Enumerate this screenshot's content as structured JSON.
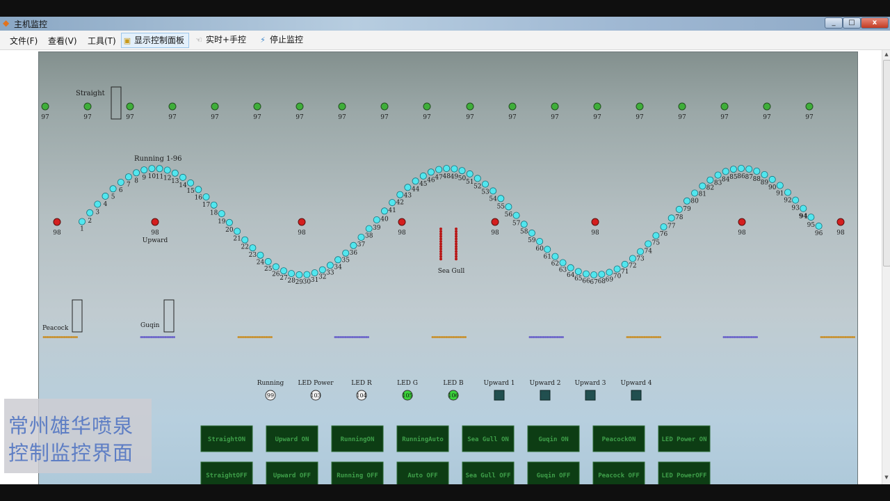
{
  "window": {
    "title": "主机监控",
    "controls": [
      "_",
      "□",
      "x"
    ]
  },
  "menu": {
    "file": "文件(F)",
    "view": "查看(V)",
    "tools": "工具(T)",
    "show_panel": "显示控制面板",
    "realtime": "实时+手控",
    "stop": "停止监控"
  },
  "labels": {
    "straight": "Straight",
    "running": "Running 1-96",
    "upward": "Upward",
    "seagull": "Sea Gull",
    "peacock": "Peacock",
    "guqin": "Guqin"
  },
  "straight_value": "97",
  "running_start": 1,
  "running_end": 96,
  "red_value": "98",
  "colors": {
    "green": "#3fae3a",
    "cyan": "#52e6ee",
    "red": "#d41f1f",
    "button_bg": "#0d3d14",
    "button_text": "#3fa04a"
  },
  "indicators": [
    {
      "label": "Running",
      "value": "99",
      "type": "circle",
      "on": false
    },
    {
      "label": "LED Power",
      "value": "103",
      "type": "circle",
      "on": false
    },
    {
      "label": "LED R",
      "value": "104",
      "type": "circle",
      "on": false
    },
    {
      "label": "LED G",
      "value": "105",
      "type": "circle",
      "on": true
    },
    {
      "label": "LED B",
      "value": "106",
      "type": "circle",
      "on": true
    },
    {
      "label": "Upward 1",
      "type": "square"
    },
    {
      "label": "Upward 2",
      "type": "square"
    },
    {
      "label": "Upward 3",
      "type": "square"
    },
    {
      "label": "Upward 4",
      "type": "square"
    }
  ],
  "buttons_on": [
    "StraightON",
    "Upward ON",
    "RunningON",
    "RunningAuto",
    "Sea Gull ON",
    "Guqin ON",
    "PeacockON",
    "LED Power ON"
  ],
  "buttons_off": [
    "StraightOFF",
    "Upward OFF",
    "Running OFF",
    "Auto OFF",
    "Sea Gull OFF",
    "Guqin OFF",
    "Peacock OFF",
    "LED PowerOFF"
  ],
  "watermark": {
    "line1": "常州雄华喷泉",
    "line2": "控制监控界面"
  }
}
